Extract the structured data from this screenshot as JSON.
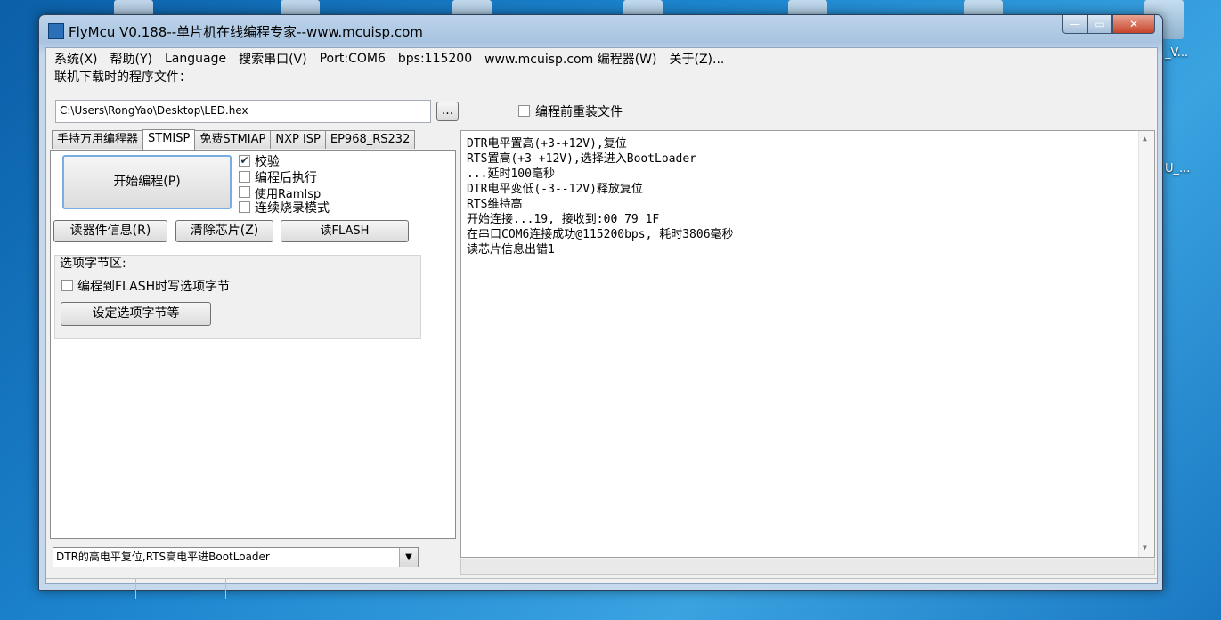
{
  "desktop": {
    "right_labels": [
      "_V...",
      "U_..."
    ]
  },
  "window": {
    "title": "FlyMcu V0.188--单片机在线编程专家--www.mcuisp.com",
    "controls": {
      "minimize": "—",
      "maximize": "▭",
      "close": "✕"
    }
  },
  "menu": {
    "items": [
      "系统(X)",
      "帮助(Y)",
      "Language",
      "搜索串口(V)",
      "Port:COM6",
      "bps:115200",
      "www.mcuisp.com 编程器(W)",
      "关于(Z)..."
    ]
  },
  "file": {
    "label": "联机下载时的程序文件：",
    "path": "C:\\Users\\RongYao\\Desktop\\LED.hex",
    "browse_label": "...",
    "reload_label": "编程前重装文件",
    "reload_checked": false
  },
  "tabs": [
    {
      "label": "手持万用编程器",
      "active": false
    },
    {
      "label": "STMISP",
      "active": true
    },
    {
      "label": "免费STMIAP",
      "active": false
    },
    {
      "label": "NXP ISP",
      "active": false
    },
    {
      "label": "EP968_RS232",
      "active": false
    }
  ],
  "stmisp": {
    "start_button": "开始编程(P)",
    "options": [
      {
        "label": "校验",
        "checked": true
      },
      {
        "label": "编程后执行",
        "checked": false
      },
      {
        "label": "使用RamIsp",
        "checked": false
      },
      {
        "label": "连续烧录模式",
        "checked": false
      }
    ],
    "read_info_button": "读器件信息(R)",
    "erase_button": "清除芯片(Z)",
    "read_flash_button": "读FLASH",
    "option_group_label": "选项字节区:",
    "write_option_label": "编程到FLASH时写选项字节",
    "write_option_checked": false,
    "set_option_button": "设定选项字节等"
  },
  "reset_mode": {
    "selected": "DTR的高电平复位,RTS高电平进BootLoader"
  },
  "log": {
    "lines": [
      "DTR电平置高(+3-+12V),复位",
      "RTS置高(+3-+12V),选择进入BootLoader",
      "...延时100毫秒",
      "DTR电平变低(-3--12V)释放复位",
      "RTS维持高",
      "开始连接...19, 接收到:00 79 1F",
      "在串口COM6连接成功@115200bps, 耗时3806毫秒",
      "读芯片信息出错1"
    ]
  },
  "colors": {
    "desktop_blue": "#1d86cf",
    "window_frame": "#a9c4e1",
    "close_red": "#c7432a",
    "checkmark": "#234"
  }
}
